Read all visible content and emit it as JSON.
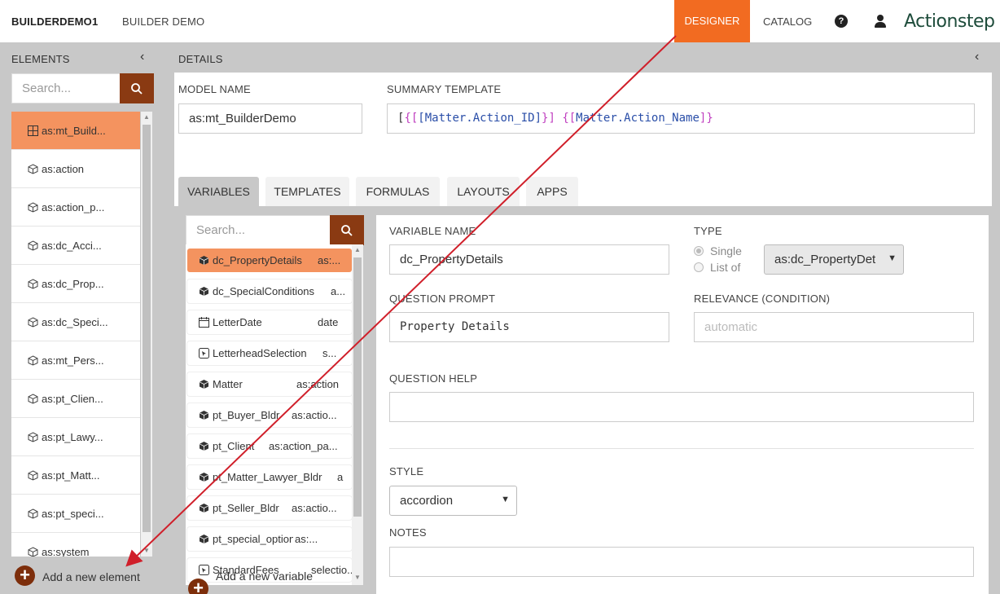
{
  "topbar": {
    "brand": "BUILDERDEMO1",
    "app_name": "BUILDER DEMO",
    "nav_designer": "DESIGNER",
    "nav_catalog": "CATALOG",
    "help_glyph": "?",
    "logo": "Actionstep",
    "accent_color": "#f26b21"
  },
  "elements_panel": {
    "title": "ELEMENTS",
    "search_placeholder": "Search...",
    "items": [
      {
        "label": "as:mt_Build...",
        "icon": "grid-icon",
        "active": true
      },
      {
        "label": "as:action",
        "icon": "cube-outline-icon"
      },
      {
        "label": "as:action_p...",
        "icon": "cube-outline-icon"
      },
      {
        "label": "as:dc_Acci...",
        "icon": "cube-outline-icon"
      },
      {
        "label": "as:dc_Prop...",
        "icon": "cube-outline-icon"
      },
      {
        "label": "as:dc_Speci...",
        "icon": "cube-outline-icon"
      },
      {
        "label": "as:mt_Pers...",
        "icon": "cube-outline-icon"
      },
      {
        "label": "as:pt_Clien...",
        "icon": "cube-outline-icon"
      },
      {
        "label": "as:pt_Lawy...",
        "icon": "cube-outline-icon"
      },
      {
        "label": "as:pt_Matt...",
        "icon": "cube-outline-icon"
      },
      {
        "label": "as:pt_speci...",
        "icon": "cube-outline-icon"
      },
      {
        "label": "as:system",
        "icon": "cube-outline-icon"
      }
    ],
    "add_label": "Add a new element"
  },
  "details": {
    "title": "DETAILS",
    "model_name_label": "MODEL NAME",
    "model_name_value": "as:mt_BuilderDemo",
    "summary_label": "SUMMARY TEMPLATE",
    "summary_parts": {
      "p1": "[",
      "p2": "{[",
      "p3": "[Matter.Action_ID]",
      "p4": "}]",
      "p5": " ",
      "p6": "{[",
      "p7": "Matter.Action_Name",
      "p8": "]}"
    },
    "tabs": [
      "VARIABLES",
      "TEMPLATES",
      "FORMULAS",
      "LAYOUTS",
      "APPS"
    ]
  },
  "variables": {
    "search_placeholder": "Search...",
    "items": [
      {
        "name": "dc_PropertyDetails",
        "type": "as:...",
        "icon": "cube-solid-icon",
        "active": true
      },
      {
        "name": "dc_SpecialConditions",
        "type": "a...",
        "icon": "cube-solid-icon"
      },
      {
        "name": "LetterDate",
        "type": "date",
        "icon": "calendar-icon"
      },
      {
        "name": "LetterheadSelection",
        "type": "s...",
        "icon": "selection-icon"
      },
      {
        "name": "Matter",
        "type": "as:action",
        "icon": "cube-solid-icon"
      },
      {
        "name": "pt_Buyer_Bldr",
        "type": "as:actio...",
        "icon": "cube-solid-icon"
      },
      {
        "name": "pt_Client",
        "type": "as:action_pa...",
        "icon": "cube-solid-icon"
      },
      {
        "name": "pt_Matter_Lawyer_Bldr",
        "type": "a",
        "icon": "cube-solid-icon"
      },
      {
        "name": "pt_Seller_Bldr",
        "type": "as:actio...",
        "icon": "cube-solid-icon"
      },
      {
        "name": "pt_special_options",
        "type": "as:...",
        "icon": "cube-solid-icon"
      },
      {
        "name": "StandardFees",
        "type": "selectio...",
        "icon": "selection-icon"
      }
    ],
    "add_label": "Add a new variable"
  },
  "form": {
    "variable_name_label": "VARIABLE NAME",
    "variable_name_value": "dc_PropertyDetails",
    "type_label": "TYPE",
    "radio_single": "Single",
    "radio_list": "List of",
    "type_select_value": "as:dc_PropertyDet",
    "question_prompt_label": "QUESTION PROMPT",
    "question_prompt_value": "Property Details",
    "relevance_label": "RELEVANCE (CONDITION)",
    "relevance_placeholder": "automatic",
    "question_help_label": "QUESTION HELP",
    "style_label": "STYLE",
    "style_value": "accordion",
    "notes_label": "NOTES"
  }
}
